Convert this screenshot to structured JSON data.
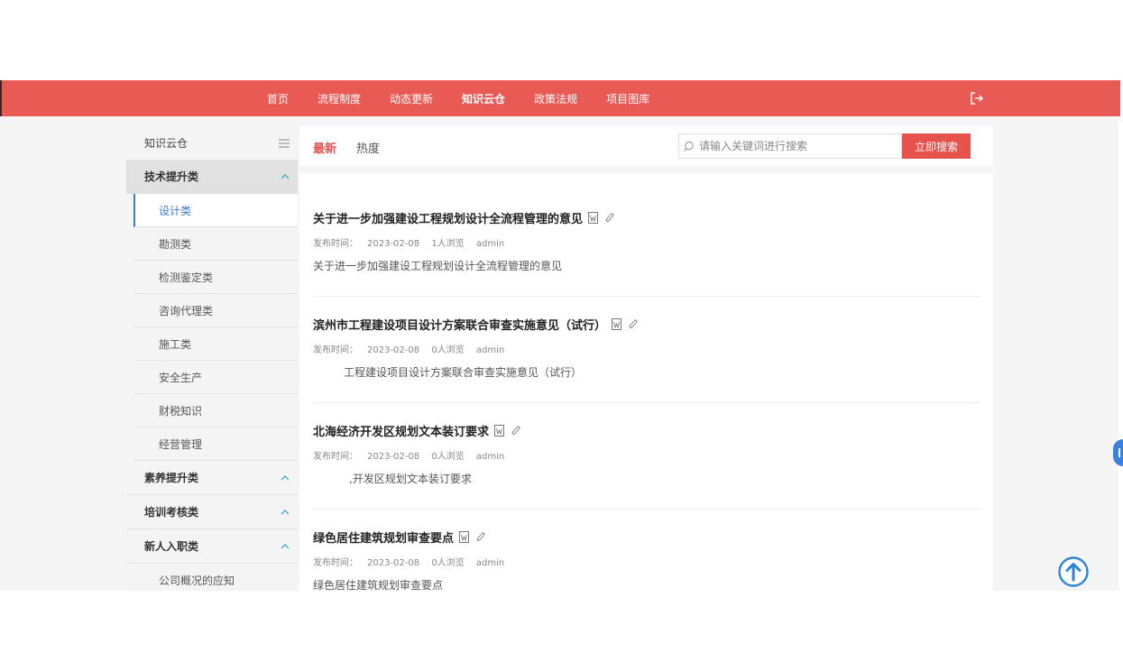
{
  "nav": {
    "items": [
      "首页",
      "流程制度",
      "动态更新",
      "知识云仓",
      "政策法规",
      "项目图库"
    ],
    "active_index": 3,
    "logout_icon": "logout-icon"
  },
  "sidebar": {
    "header": "知识云仓",
    "header_icon": "menu-icon",
    "groups": [
      {
        "label": "技术提升类",
        "expanded": true
      },
      {
        "label": "素养提升类",
        "expanded": false
      },
      {
        "label": "培训考核类",
        "expanded": false
      },
      {
        "label": "新人入职类",
        "expanded": true
      }
    ],
    "tech_items": [
      "设计类",
      "勘测类",
      "检测鉴定类",
      "咨询代理类",
      "施工类",
      "安全生产",
      "财税知识",
      "经营管理"
    ],
    "newbie_items": [
      "公司概况的应知"
    ],
    "active_item": "设计类"
  },
  "tabs": {
    "latest": "最新",
    "hot": "热度"
  },
  "search": {
    "placeholder": "请输入关键词进行搜索",
    "button": "立即搜索"
  },
  "articles": [
    {
      "title": "关于进一步加强建设工程规划设计全流程管理的意见",
      "meta_label": "发布时间：",
      "date": "2023-02-08",
      "views": "1人浏览",
      "author": "admin",
      "summary": "关于进一步加强建设工程规划设计全流程管理的意见"
    },
    {
      "title": "滨州市工程建设项目设计方案联合审查实施意见（试行）",
      "meta_label": "发布时间：",
      "date": "2023-02-08",
      "views": "0人浏览",
      "author": "admin",
      "summary": "工程建设项目设计方案联合审查实施意见（试行）"
    },
    {
      "title": "北海经济开发区规划文本装订要求",
      "meta_label": "发布时间：",
      "date": "2023-02-08",
      "views": "0人浏览",
      "author": "admin",
      "summary": ",开发区规划文本装订要求"
    },
    {
      "title": "绿色居住建筑规划审查要点",
      "meta_label": "发布时间：",
      "date": "2023-02-08",
      "views": "0人浏览",
      "author": "admin",
      "summary": "绿色居住建筑规划审查要点"
    }
  ],
  "colors": {
    "accent": "#e8524d",
    "nav_bg": "#ea5a55",
    "active_blue": "#3b7cd6"
  },
  "back_to_top_icon": "arrow-up-circle-icon"
}
